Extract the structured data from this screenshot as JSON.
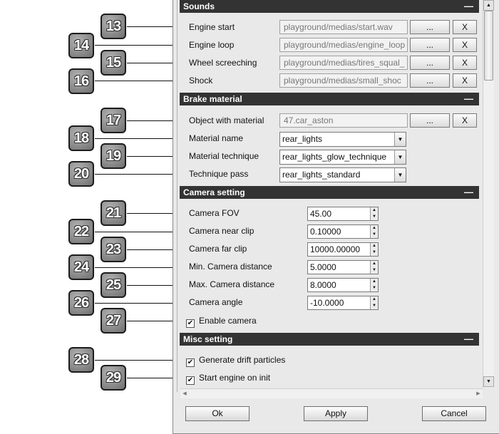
{
  "sections": {
    "sounds": "Sounds",
    "brake_material": "Brake material",
    "camera_setting": "Camera setting",
    "misc_setting": "Misc setting",
    "collapse_glyph": "—"
  },
  "sounds": [
    {
      "label": "Engine start",
      "value": "playground/medias/start.wav"
    },
    {
      "label": "Engine loop",
      "value": "playground/medias/engine_loop"
    },
    {
      "label": "Wheel screeching",
      "value": "playground/medias/tires_squal_"
    },
    {
      "label": "Shock",
      "value": "playground/medias/small_shoc"
    }
  ],
  "brake": {
    "object_label": "Object with material",
    "object_value": "47.car_aston",
    "material_name_label": "Material name",
    "material_name_value": "rear_lights",
    "material_technique_label": "Material technique",
    "material_technique_value": "rear_lights_glow_technique",
    "technique_pass_label": "Technique pass",
    "technique_pass_value": "rear_lights_standard"
  },
  "buttons": {
    "browse": "...",
    "clear": "X"
  },
  "camera": [
    {
      "label": "Camera FOV",
      "value": "45.00"
    },
    {
      "label": "Camera near clip",
      "value": "0.10000"
    },
    {
      "label": "Camera far clip",
      "value": "10000.00000"
    },
    {
      "label": "Min. Camera distance",
      "value": "5.0000"
    },
    {
      "label": "Max. Camera distance",
      "value": "8.0000"
    },
    {
      "label": "Camera angle",
      "value": "-10.0000"
    }
  ],
  "enable_camera": {
    "label": "Enable camera",
    "checked": true
  },
  "misc": [
    {
      "label": "Generate drift particles",
      "checked": true
    },
    {
      "label": "Start engine on init",
      "checked": true
    }
  ],
  "footer": {
    "ok": "Ok",
    "apply": "Apply",
    "cancel": "Cancel"
  },
  "callouts": [
    "13",
    "14",
    "15",
    "16",
    "17",
    "18",
    "19",
    "20",
    "21",
    "22",
    "23",
    "24",
    "25",
    "26",
    "27",
    "28",
    "29"
  ],
  "glyphs": {
    "check": "✔",
    "dropdown": "▼",
    "up": "▲",
    "down": "▼",
    "left": "◀",
    "right": "▶"
  },
  "colors": {
    "header_bg": "#333333",
    "panel_bg": "#e9e9e9",
    "callout_fill": "#8a8a8a"
  }
}
